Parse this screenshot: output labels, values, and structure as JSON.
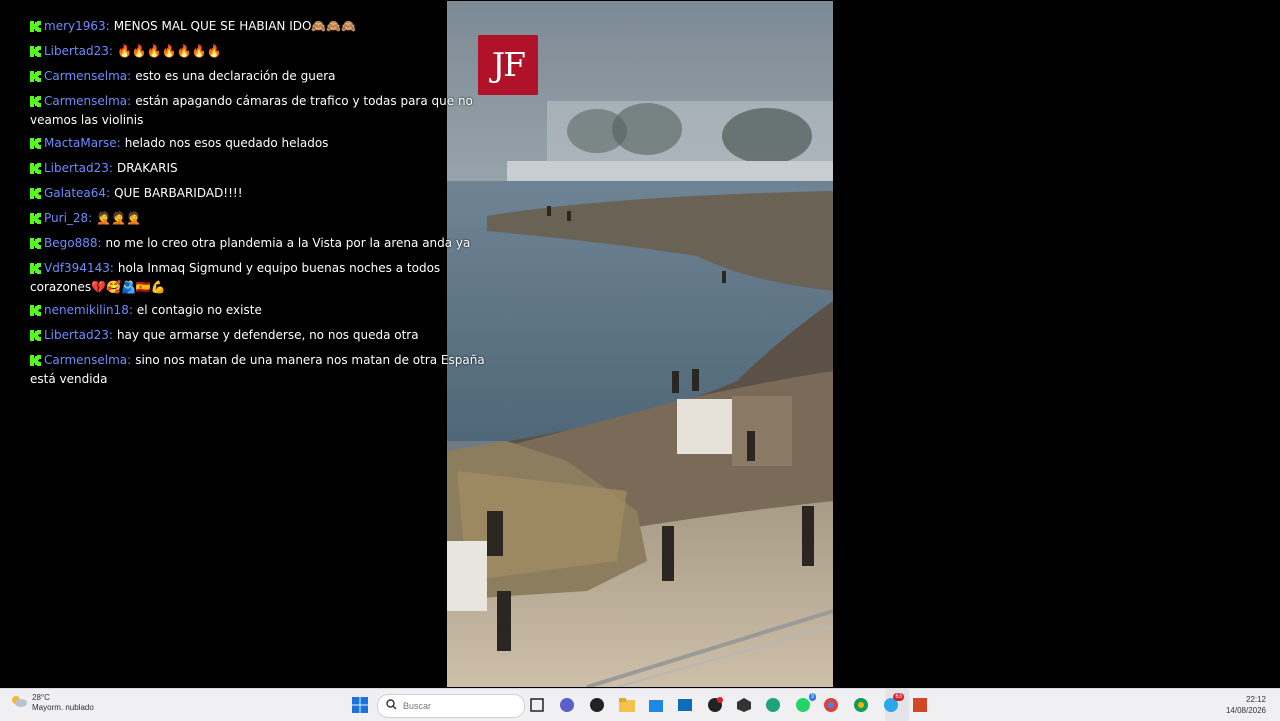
{
  "video": {
    "logo_text": "JF"
  },
  "chat": {
    "messages": [
      {
        "user": "mery1963",
        "text": "MENOS MAL QUE SE HABIAN IDO",
        "emoji": "🙈🙈🙈"
      },
      {
        "user": "Libertad23",
        "text": "",
        "emoji": "🔥🔥🔥🔥🔥🔥🔥"
      },
      {
        "user": "Carmenselma",
        "text": "esto es una declaración de guera",
        "emoji": ""
      },
      {
        "user": "Carmenselma",
        "text": "están apagando cámaras de trafico y todas para que no veamos las violinis",
        "emoji": ""
      },
      {
        "user": "MactaMarse",
        "text": "helado nos esos quedado helados",
        "emoji": ""
      },
      {
        "user": "Libertad23",
        "text": "DRAKARIS",
        "emoji": ""
      },
      {
        "user": "Galatea64",
        "text": "QUE BARBARIDAD!!!!",
        "emoji": ""
      },
      {
        "user": "Puri_28",
        "text": "",
        "emoji": "🤦🤦🤦"
      },
      {
        "user": "Bego888",
        "text": "no me lo creo otra plandemia a la Vista por la arena anda ya",
        "emoji": ""
      },
      {
        "user": "Vdf394143",
        "text": "hola Inmaq Sigmund y equipo buenas noches a todos corazones",
        "emoji": "💔🥰🫂🇪🇸💪"
      },
      {
        "user": "nenemikilin18",
        "text": "el contagio no existe",
        "emoji": ""
      },
      {
        "user": "Libertad23",
        "text": "hay que armarse y defenderse, no nos queda otra",
        "emoji": ""
      },
      {
        "user": "Carmenselma",
        "text": "sino nos matan de una manera nos matan de otra España está vendida",
        "emoji": ""
      }
    ]
  },
  "taskbar": {
    "weather": {
      "temp": "28°C",
      "condition": "Mayorm. nublado"
    },
    "search_placeholder": "Buscar",
    "clock": {
      "time": "22:12",
      "date": "14/08/2026"
    },
    "badges": {
      "whatsapp": "3",
      "telegram": "63"
    },
    "colors": {
      "accent": "#2c7be5",
      "brand_red": "#b0122a"
    }
  }
}
